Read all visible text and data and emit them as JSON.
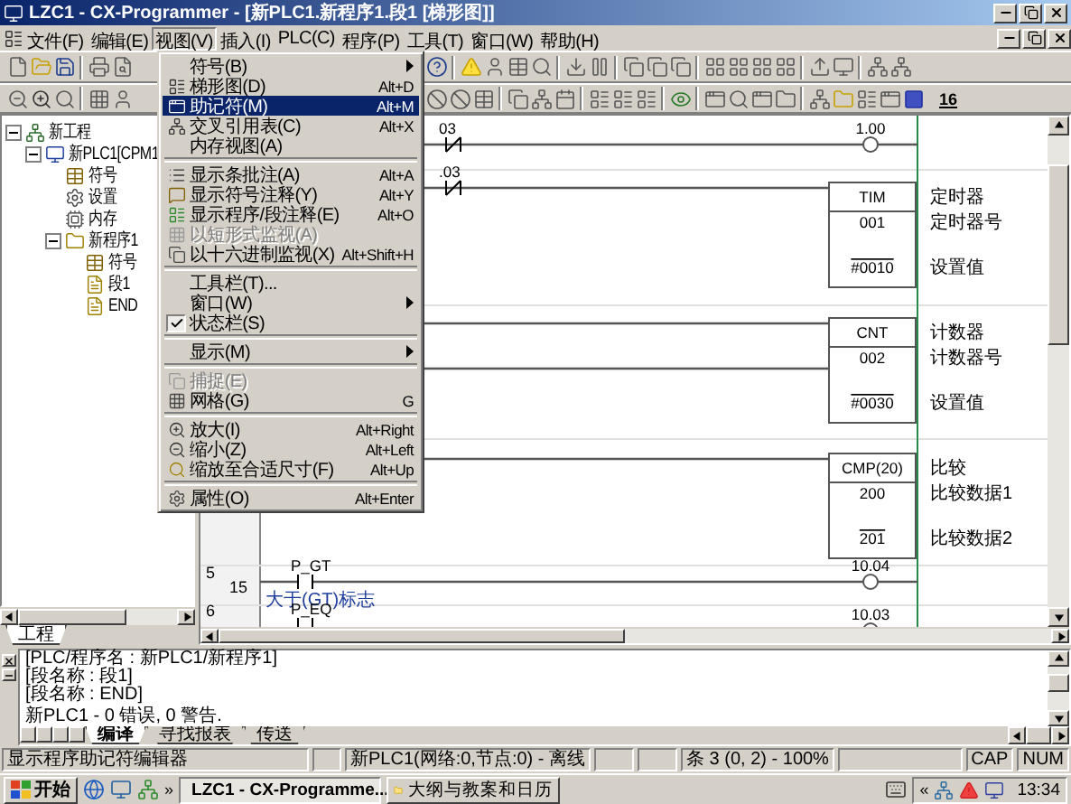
{
  "title_bar": {
    "title": "LZC1 - CX-Programmer - [新PLC1.新程序1.段1 [梯形图]]"
  },
  "menu_bar": [
    {
      "label": "文件(F)",
      "selected": false
    },
    {
      "label": "编辑(E)",
      "selected": false
    },
    {
      "label": "视图(V)",
      "selected": true
    },
    {
      "label": "插入(I)",
      "selected": false
    },
    {
      "label": "PLC(C)",
      "selected": false
    },
    {
      "label": "程序(P)",
      "selected": false
    },
    {
      "label": "工具(T)",
      "selected": false
    },
    {
      "label": "窗口(W)",
      "selected": false
    },
    {
      "label": "帮助(H)",
      "selected": false
    }
  ],
  "toolbar_2": {
    "hex_button_label": "16"
  },
  "view_menu": {
    "items": [
      {
        "kind": "item",
        "label": "符号(B)",
        "submenu": true,
        "selected": false,
        "disabled": false,
        "checked": false
      },
      {
        "kind": "item",
        "label": "梯形图(D)",
        "shortcut": "Alt+D",
        "submenu": false,
        "selected": false,
        "disabled": false,
        "checked": false
      },
      {
        "kind": "item",
        "label": "助记符(M)",
        "shortcut": "Alt+M",
        "submenu": false,
        "selected": true,
        "disabled": false,
        "checked": false
      },
      {
        "kind": "item",
        "label": "交叉引用表(C)",
        "shortcut": "Alt+X",
        "submenu": false,
        "selected": false,
        "disabled": false,
        "checked": false
      },
      {
        "kind": "item",
        "label": "内存视图(A)",
        "submenu": false,
        "selected": false,
        "disabled": false,
        "checked": false
      },
      {
        "kind": "separator"
      },
      {
        "kind": "item",
        "label": "显示条批注(A)",
        "shortcut": "Alt+A",
        "submenu": false,
        "selected": false,
        "disabled": false,
        "checked": false
      },
      {
        "kind": "item",
        "label": "显示符号注释(Y)",
        "shortcut": "Alt+Y",
        "submenu": false,
        "selected": false,
        "disabled": false,
        "checked": false
      },
      {
        "kind": "item",
        "label": "显示程序/段注释(E)",
        "shortcut": "Alt+O",
        "submenu": false,
        "selected": false,
        "disabled": false,
        "checked": false
      },
      {
        "kind": "item",
        "label": "以短形式监视(A)",
        "submenu": false,
        "selected": false,
        "disabled": true,
        "checked": false
      },
      {
        "kind": "item",
        "label": "以十六进制监视(X)",
        "shortcut": "Alt+Shift+H",
        "submenu": false,
        "selected": false,
        "disabled": false,
        "checked": false
      },
      {
        "kind": "separator"
      },
      {
        "kind": "item",
        "label": "工具栏(T)...",
        "submenu": false,
        "selected": false,
        "disabled": false,
        "checked": false
      },
      {
        "kind": "item",
        "label": "窗口(W)",
        "submenu": true,
        "selected": false,
        "disabled": false,
        "checked": false
      },
      {
        "kind": "item",
        "label": "状态栏(S)",
        "submenu": false,
        "selected": false,
        "disabled": false,
        "checked": true
      },
      {
        "kind": "separator"
      },
      {
        "kind": "item",
        "label": "显示(M)",
        "submenu": true,
        "selected": false,
        "disabled": false,
        "checked": false
      },
      {
        "kind": "separator"
      },
      {
        "kind": "item",
        "label": "捕捉(E)",
        "submenu": false,
        "selected": false,
        "disabled": true,
        "checked": false
      },
      {
        "kind": "item",
        "label": "网格(G)",
        "shortcut": "G",
        "submenu": false,
        "selected": false,
        "disabled": false,
        "checked": false
      },
      {
        "kind": "separator"
      },
      {
        "kind": "item",
        "label": "放大(I)",
        "shortcut": "Alt+Right",
        "submenu": false,
        "selected": false,
        "disabled": false,
        "checked": false
      },
      {
        "kind": "item",
        "label": "缩小(Z)",
        "shortcut": "Alt+Left",
        "submenu": false,
        "selected": false,
        "disabled": false,
        "checked": false
      },
      {
        "kind": "item",
        "label": "缩放至合适尺寸(F)",
        "shortcut": "Alt+Up",
        "submenu": false,
        "selected": false,
        "disabled": false,
        "checked": false
      },
      {
        "kind": "separator"
      },
      {
        "kind": "item",
        "label": "属性(O)",
        "shortcut": "Alt+Enter",
        "submenu": false,
        "selected": false,
        "disabled": false,
        "checked": false
      }
    ]
  },
  "project_tree": {
    "nodes": [
      {
        "label": "新工程",
        "kind": "project",
        "expanded": true,
        "children": [
          {
            "label": "新PLC1[CPM1",
            "kind": "plc",
            "expanded": true,
            "children": [
              {
                "label": "符号",
                "kind": "symbols"
              },
              {
                "label": "设置",
                "kind": "settings"
              },
              {
                "label": "内存",
                "kind": "memory"
              },
              {
                "label": "新程序1",
                "kind": "program",
                "expanded": true,
                "children": [
                  {
                    "label": "符号",
                    "kind": "symbols"
                  },
                  {
                    "label": "段1",
                    "kind": "section"
                  },
                  {
                    "label": "END",
                    "kind": "section"
                  }
                ]
              }
            ]
          }
        ]
      }
    ],
    "tabs": [
      {
        "label": "工程",
        "selected": true
      }
    ]
  },
  "ladder": {
    "rows": [
      {
        "row_number": "5",
        "step": "15"
      },
      {
        "row_number": "6"
      }
    ],
    "contacts": [
      {
        "label": "03",
        "kind": "nc"
      },
      {
        "label": ".03",
        "kind": "nc"
      },
      {
        "label": "P_GT",
        "kind": "no",
        "comment": "大于(GT)标志"
      },
      {
        "label": "P_EQ",
        "kind": "no"
      }
    ],
    "coils": [
      {
        "label": "1.00"
      },
      {
        "label": "10.04"
      },
      {
        "label": "10.03"
      }
    ],
    "blocks": [
      {
        "name": "TIM",
        "operand_1": "001",
        "operand_2": "#0010",
        "comments": [
          "定时器",
          "定时器号",
          "设置值"
        ]
      },
      {
        "name": "CNT",
        "operand_1": "002",
        "operand_2": "#0030",
        "comments": [
          "计数器",
          "计数器号",
          "设置值"
        ]
      },
      {
        "name": "CMP(20)",
        "operand_1": "200",
        "operand_2": "201",
        "comments": [
          "比较",
          "比较数据1",
          "比较数据2"
        ]
      }
    ]
  },
  "output": {
    "lines": [
      {
        "text": "[PLC/程序名 : 新PLC1/新程序1]",
        "gap_before": false
      },
      {
        "text": "[段名称 : 段1]",
        "gap_before": false
      },
      {
        "text": "[段名称 : END]",
        "gap_before": false
      },
      {
        "text": "新PLC1 - 0 错误, 0 警告.",
        "gap_before": true
      }
    ],
    "tabs": [
      {
        "label": "编译",
        "selected": true
      },
      {
        "label": "寻找报表",
        "selected": false
      },
      {
        "label": "传送",
        "selected": false
      }
    ]
  },
  "status_bar": {
    "panels": [
      "显示程序助记符编辑器",
      "新PLC1(网络:0,节点:0) - 离线",
      "条 3 (0, 2) - 100%",
      "CAP",
      "NUM"
    ]
  },
  "taskbar": {
    "start_label": "开始",
    "quick_launch_more": "»",
    "tasks": [
      {
        "label": "LZC1 - CX-Programme...",
        "selected": true
      },
      {
        "label": "大纲与教案和日历",
        "selected": false
      }
    ],
    "tray_expand": "«",
    "clock": "13:34"
  }
}
